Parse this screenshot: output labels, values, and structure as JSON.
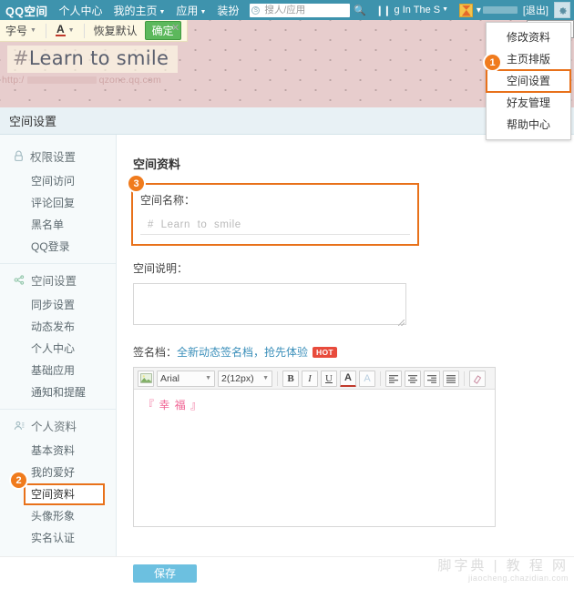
{
  "topnav": {
    "brand": "QQ空间",
    "links": [
      {
        "label": "个人中心",
        "caret": false
      },
      {
        "label": "我的主页",
        "caret": true
      },
      {
        "label": "应用",
        "caret": true
      },
      {
        "label": "装扮",
        "caret": false
      }
    ],
    "search": {
      "placeholder": "搜人/应用",
      "value": "",
      "icon": "search-circle-icon"
    },
    "music": {
      "label": "g In The S",
      "caret": true,
      "icon": "pause-icon"
    },
    "logout": "[退出]",
    "gear_icon": "gear-icon",
    "gear_tooltip": "空间设置"
  },
  "dropdown": {
    "items": [
      {
        "label": "修改资料",
        "highlighted": false
      },
      {
        "label": "主页排版",
        "highlighted": false
      },
      {
        "label": "空间设置",
        "highlighted": true
      },
      {
        "label": "好友管理",
        "highlighted": false
      },
      {
        "label": "帮助中心",
        "highlighted": false
      }
    ]
  },
  "banner": {
    "font_toolbar": {
      "size_label": "字号",
      "color_label": "A",
      "reset_label": "恢复默认",
      "ok_label": "确定",
      "close_icon": "close-icon"
    },
    "site_title_hash": "#",
    "site_title": "Learn to smile",
    "url_prefix": "http:/",
    "url_suffix": "qzone.qq.com"
  },
  "page_header": {
    "title": "空间设置"
  },
  "sidebar": {
    "groups": [
      {
        "icon": "lock-icon",
        "title": "权限设置",
        "items": [
          {
            "label": "空间访问",
            "highlighted": false
          },
          {
            "label": "评论回复",
            "highlighted": false
          },
          {
            "label": "黑名单",
            "highlighted": false
          },
          {
            "label": "QQ登录",
            "highlighted": false
          }
        ]
      },
      {
        "icon": "share-icon",
        "title": "空间设置",
        "items": [
          {
            "label": "同步设置",
            "highlighted": false
          },
          {
            "label": "动态发布",
            "highlighted": false
          },
          {
            "label": "个人中心",
            "highlighted": false
          },
          {
            "label": "基础应用",
            "highlighted": false
          },
          {
            "label": "通知和提醒",
            "highlighted": false
          }
        ]
      },
      {
        "icon": "user-icon",
        "title": "个人资料",
        "items": [
          {
            "label": "基本资料",
            "highlighted": false
          },
          {
            "label": "我的爱好",
            "highlighted": false
          },
          {
            "label": "空间资料",
            "highlighted": true
          },
          {
            "label": "头像形象",
            "highlighted": false
          },
          {
            "label": "实名认证",
            "highlighted": false
          }
        ]
      }
    ]
  },
  "main": {
    "section_title": "空间资料",
    "name_label": "空间名称：",
    "name_value": "#  Learn  to  smile",
    "desc_label": "空间说明：",
    "desc_value": "",
    "signature": {
      "label": "签名档：",
      "link": "全新动态签名档，抢先体验",
      "hot_badge": "HOT",
      "toolbar": {
        "image_icon": "image-icon",
        "font_family": "Arial",
        "font_size": "2(12px)",
        "bold": "B",
        "italic": "I",
        "underline": "U",
        "font_color": "A",
        "highlight": "A",
        "align_left_icon": "align-left-icon",
        "align_center_icon": "align-center-icon",
        "align_right_icon": "align-right-icon",
        "align_justify_icon": "align-justify-icon",
        "eraser_icon": "eraser-icon"
      },
      "content": "『 幸 福 』"
    },
    "save_label": "保存"
  },
  "watermark": {
    "line1": "脚字典 | 教 程 网",
    "line2": "jiaocheng.chazidian.com"
  },
  "badges": {
    "one": "1",
    "two": "2",
    "three": "3"
  },
  "colors": {
    "nav": "#3e93ad",
    "accent_orange": "#e8711a",
    "save": "#6cc0e0",
    "banner": "#e7cdcd"
  }
}
